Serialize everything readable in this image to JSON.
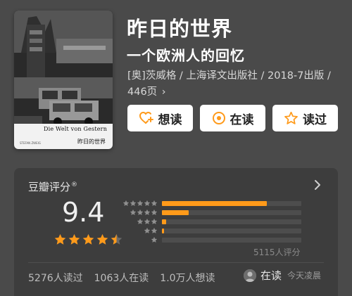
{
  "book": {
    "title": "昨日的世界",
    "subtitle": "一个欧洲人的回忆",
    "meta": "[奥]茨威格 / 上海译文出版社 / 2018-7出版 / 446页",
    "meta_chevron": "›",
    "cover": {
      "title_de": "Die Welt von Gestern",
      "title_cn": "昨日的世界",
      "small_text": "STEFAN ZWEIG"
    }
  },
  "actions": [
    {
      "label": "想读",
      "icon": "heart-plus-icon"
    },
    {
      "label": "在读",
      "icon": "target-icon"
    },
    {
      "label": "读过",
      "icon": "star-outline-icon"
    }
  ],
  "rating": {
    "section_title": "豆瓣评分",
    "section_mark": "®",
    "score": "9.4",
    "stars": 4.5,
    "distribution": [
      {
        "stars": 5,
        "fraction": 0.75
      },
      {
        "stars": 4,
        "fraction": 0.19
      },
      {
        "stars": 3,
        "fraction": 0.03
      },
      {
        "stars": 2,
        "fraction": 0.01
      },
      {
        "stars": 1,
        "fraction": 0.0
      }
    ],
    "count_label": "5115人评分"
  },
  "stats": {
    "read": "5276人读过",
    "reading": "1063人在读",
    "want": "1.0万人想读"
  },
  "reader": {
    "status": "在读",
    "time": "今天凌晨"
  },
  "colors": {
    "background": "#4a4a4a",
    "card": "#3d3d3d",
    "accent": "#ff9a1a"
  }
}
